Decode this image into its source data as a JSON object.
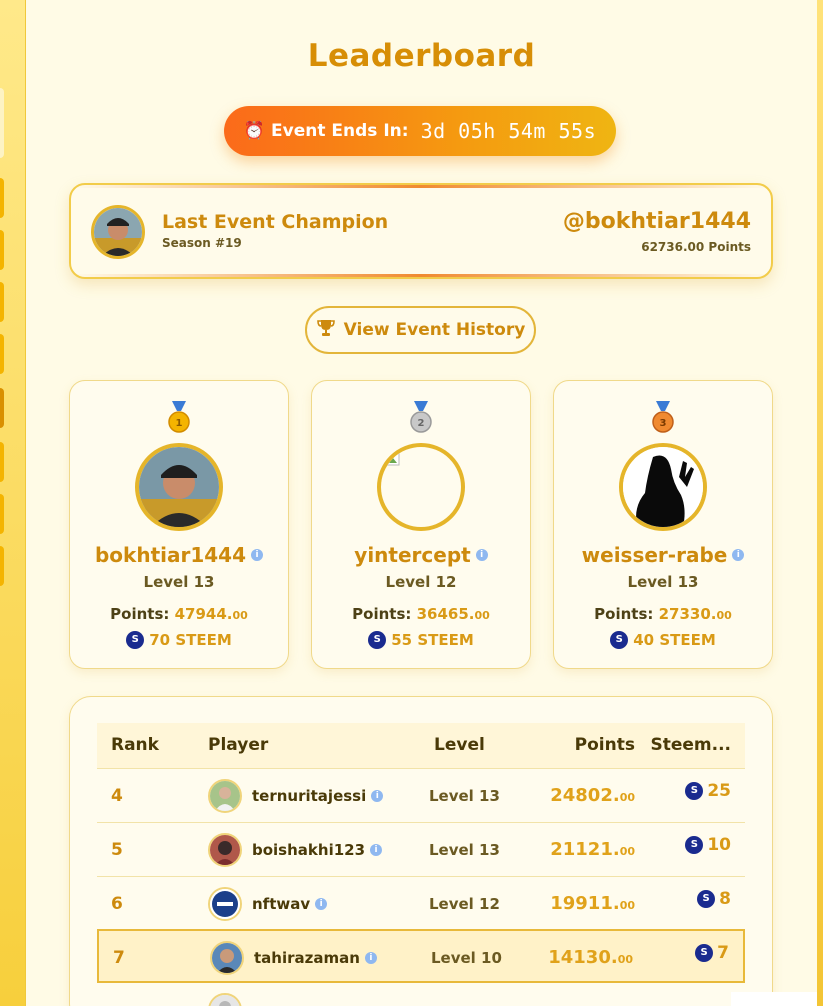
{
  "page": {
    "title": "Leaderboard"
  },
  "timer": {
    "label": "Event Ends In:",
    "time": "3d 05h 54m 55s",
    "icon": "alarm-clock-icon"
  },
  "champion": {
    "title": "Last Event Champion",
    "season": "Season #19",
    "username": "@bokhtiar1444",
    "points": "62736.00 Points"
  },
  "history_button": {
    "label": "View Event History",
    "icon": "trophy-icon"
  },
  "podium": [
    {
      "rank_icon": "gold-medal-icon",
      "medal_number": "1",
      "name": "bokhtiar1444",
      "level": "Level 13",
      "points_label": "Points:",
      "points": "47944.",
      "points_dec": "00",
      "steem": "70 STEEM"
    },
    {
      "rank_icon": "silver-medal-icon",
      "medal_number": "2",
      "name": "yintercept",
      "level": "Level 12",
      "points_label": "Points:",
      "points": "36465.",
      "points_dec": "00",
      "steem": "55 STEEM"
    },
    {
      "rank_icon": "bronze-medal-icon",
      "medal_number": "3",
      "name": "weisser-rabe",
      "level": "Level 13",
      "points_label": "Points:",
      "points": "27330.",
      "points_dec": "00",
      "steem": "40 STEEM"
    }
  ],
  "table": {
    "headers": {
      "rank": "Rank",
      "player": "Player",
      "level": "Level",
      "points": "Points",
      "steem": "Steem..."
    },
    "rows": [
      {
        "rank": "4",
        "player": "ternuritajessi",
        "level": "Level 13",
        "points": "24802.",
        "points_dec": "00",
        "steem": "25"
      },
      {
        "rank": "5",
        "player": "boishakhi123",
        "level": "Level 13",
        "points": "21121.",
        "points_dec": "00",
        "steem": "10"
      },
      {
        "rank": "6",
        "player": "nftwav",
        "level": "Level 12",
        "points": "19911.",
        "points_dec": "00",
        "steem": "8"
      },
      {
        "rank": "7",
        "player": "tahirazaman",
        "level": "Level 10",
        "points": "14130.",
        "points_dec": "00",
        "steem": "7"
      }
    ],
    "highlighted_rank": "7"
  },
  "colors": {
    "accent": "#cd8a0d",
    "timer_start": "#fb6a1a",
    "timer_end": "#efb512",
    "steem": "#1a2b8f"
  }
}
